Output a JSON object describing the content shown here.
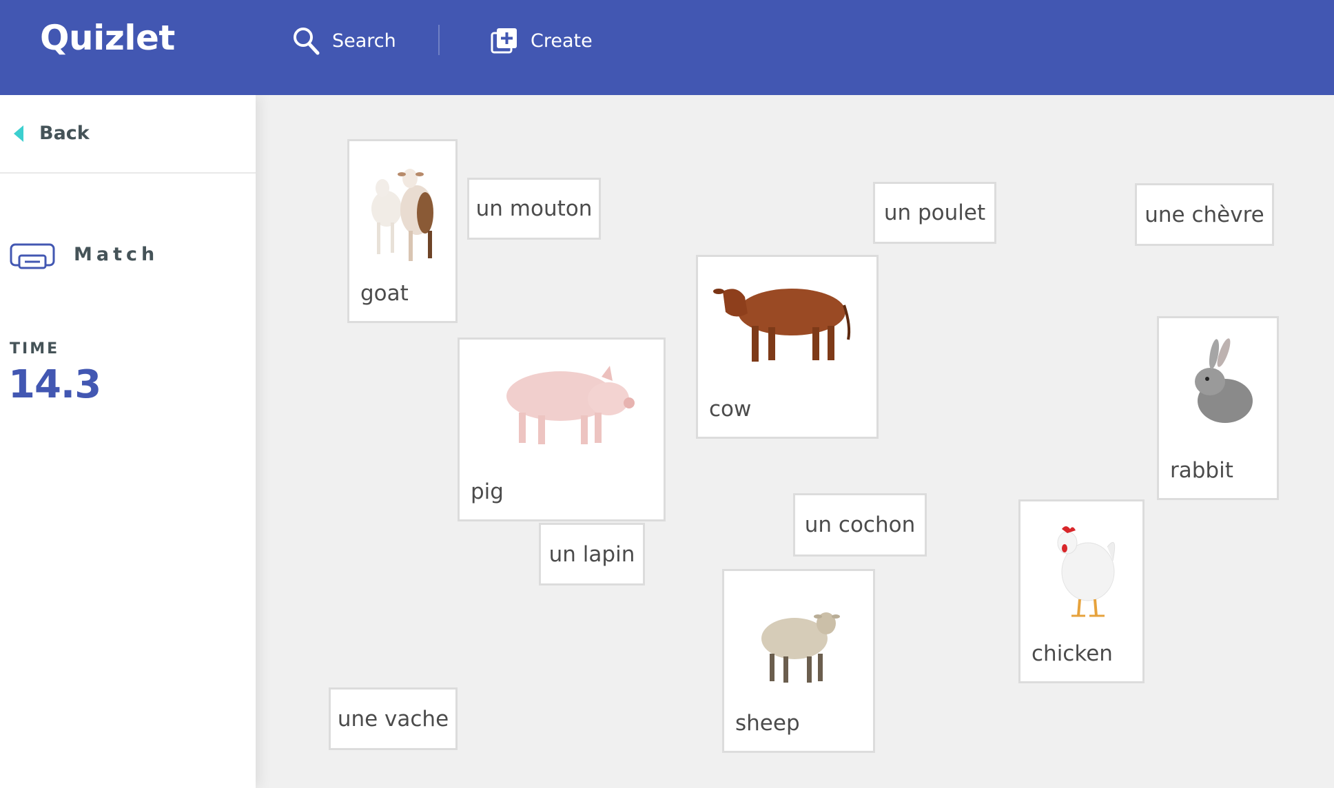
{
  "header": {
    "logo": "Quizlet",
    "search_label": "Search",
    "create_label": "Create",
    "bg_color": "#4257b2"
  },
  "sidebar": {
    "back_label": "Back",
    "mode_label": "Match",
    "time_label": "TIME",
    "time_value": "14.3"
  },
  "tiles": {
    "goat": "goat",
    "un_mouton": "un mouton",
    "un_poulet": "un poulet",
    "une_chevre": "une chèvre",
    "cow": "cow",
    "pig": "pig",
    "rabbit": "rabbit",
    "un_cochon": "un cochon",
    "un_lapin": "un lapin",
    "chicken": "chicken",
    "sheep": "sheep",
    "une_vache": "une vache"
  },
  "colors": {
    "accent": "#4257b2",
    "back_arrow": "#3ccfcf",
    "tile_border": "#dcdcdc",
    "play_bg": "#f0f0f0"
  }
}
